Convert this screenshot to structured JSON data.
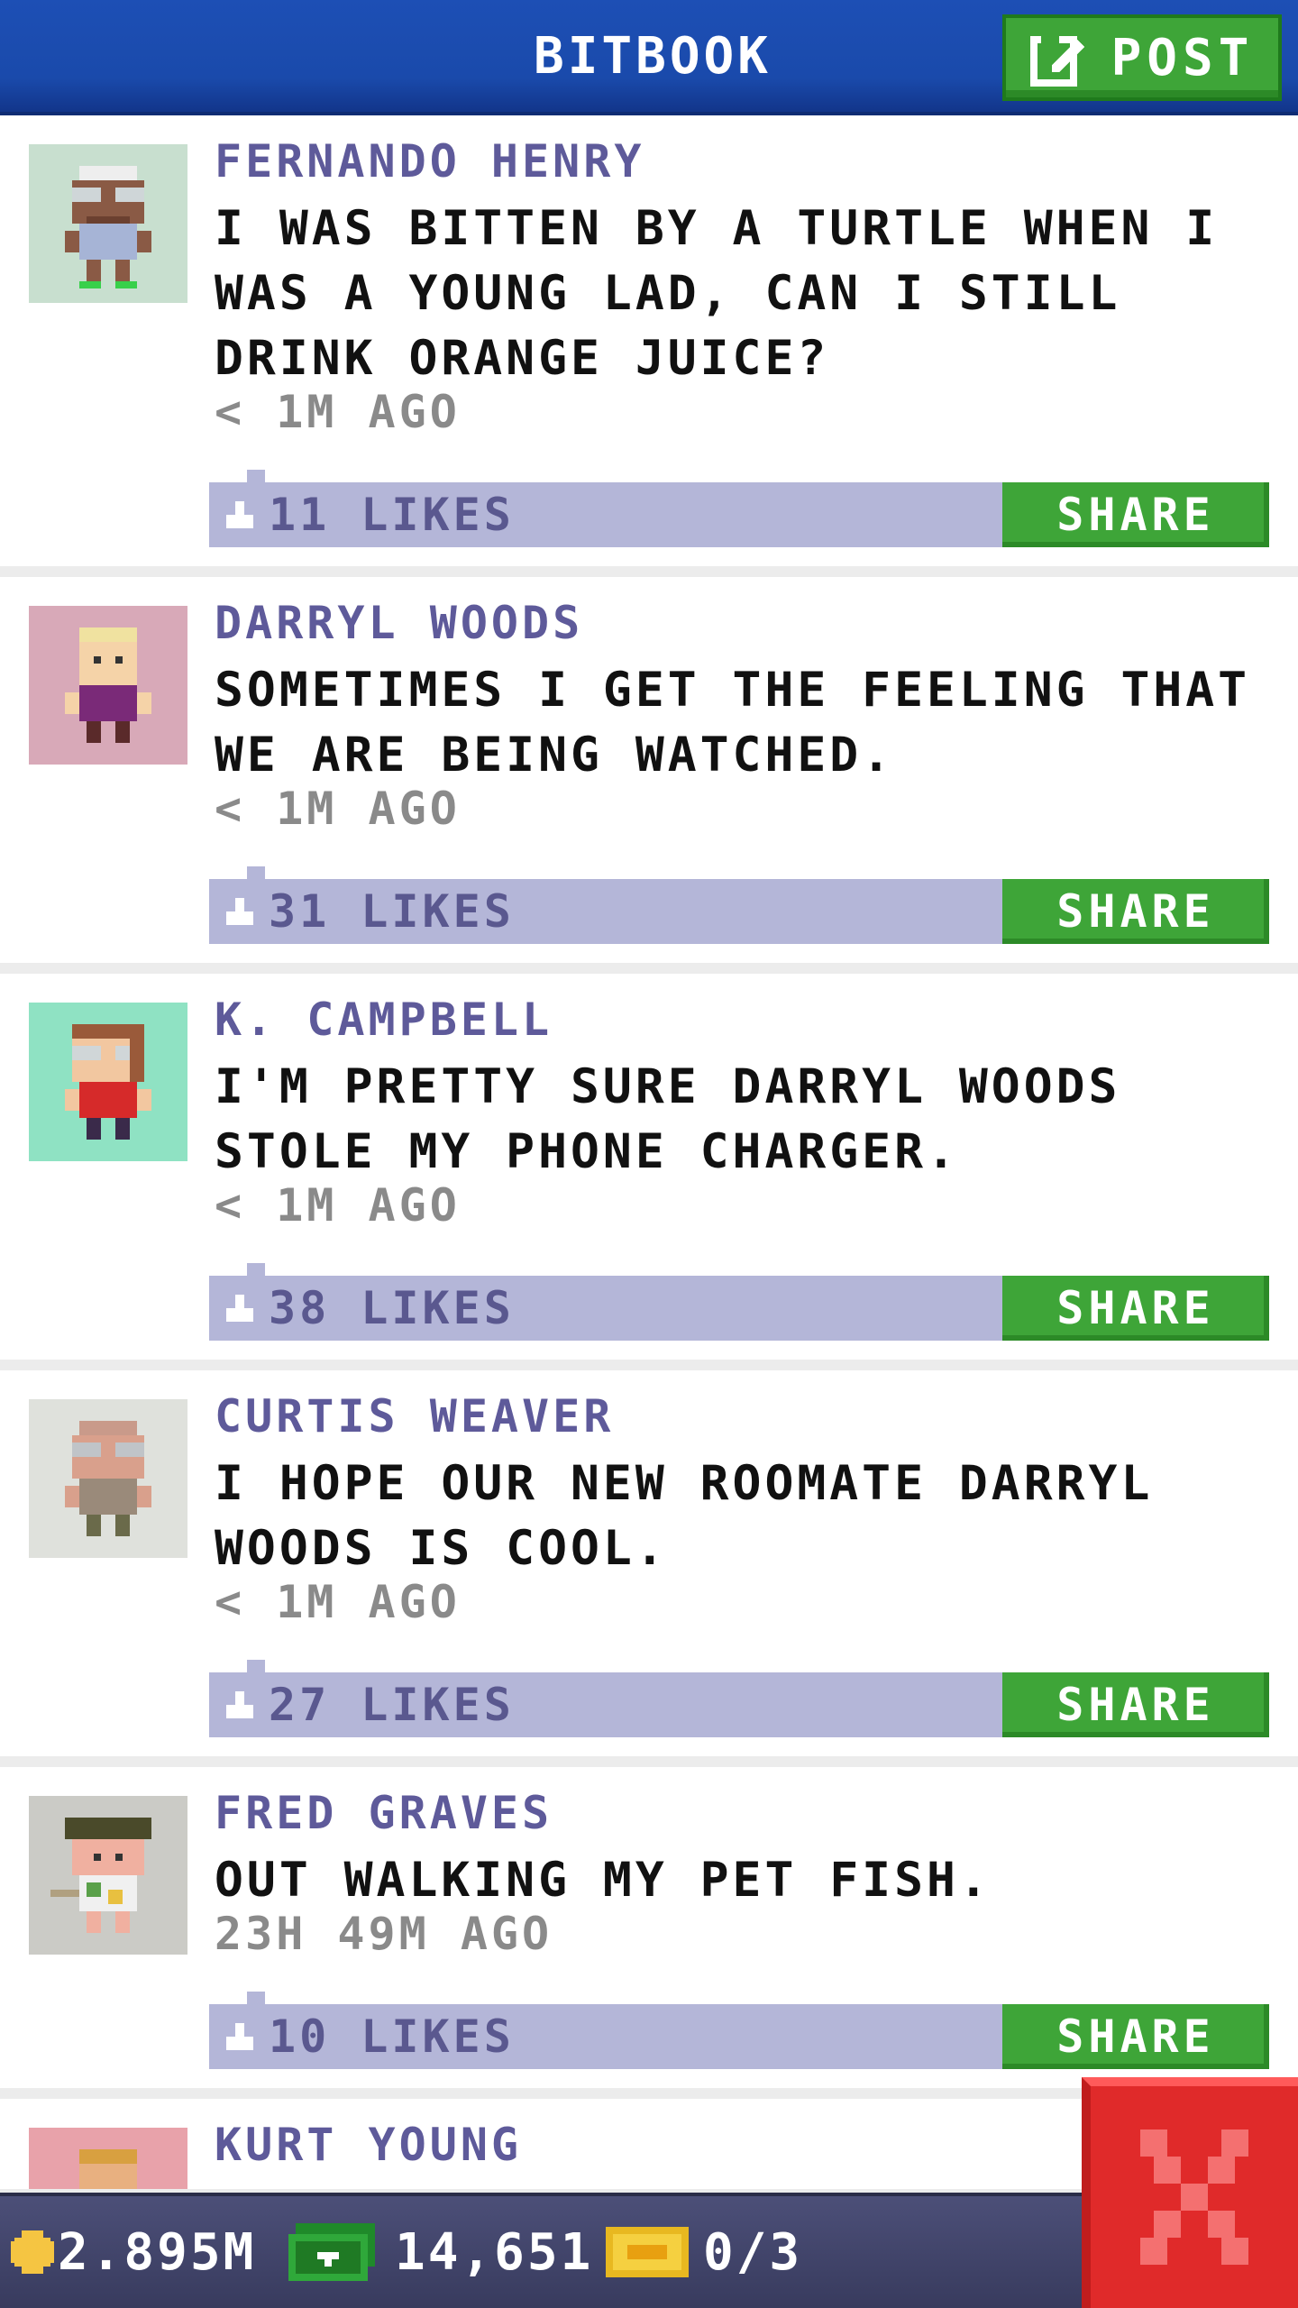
{
  "header": {
    "title": "BITBOOK",
    "post_label": "POST"
  },
  "posts": [
    {
      "author": "FERNANDO HENRY",
      "text": "I WAS BITTEN BY A TURTLE WHEN I WAS A YOUNG LAD, CAN I STILL DRINK ORANGE JUICE?",
      "time": "< 1M AGO",
      "likes": "11 LIKES",
      "share": "SHARE",
      "avatar_bg": "#c8dfcf"
    },
    {
      "author": "DARRYL WOODS",
      "text": "SOMETIMES I GET THE FEELING THAT WE ARE BEING WATCHED.",
      "time": "< 1M AGO",
      "likes": "31 LIKES",
      "share": "SHARE",
      "avatar_bg": "#d8a9b8"
    },
    {
      "author": "K. CAMPBELL",
      "text": "I'M PRETTY SURE DARRYL WOODS STOLE MY PHONE CHARGER.",
      "time": "< 1M AGO",
      "likes": "38 LIKES",
      "share": "SHARE",
      "avatar_bg": "#8fe2c3"
    },
    {
      "author": "CURTIS WEAVER",
      "text": "I HOPE OUR NEW ROOMATE DARRYL WOODS IS COOL.",
      "time": "< 1M AGO",
      "likes": "27 LIKES",
      "share": "SHARE",
      "avatar_bg": "#dfe1dc"
    },
    {
      "author": "FRED GRAVES",
      "text": "OUT WALKING MY PET FISH.",
      "time": "23H 49M AGO",
      "likes": "10 LIKES",
      "share": "SHARE",
      "avatar_bg": "#cbcbc6"
    },
    {
      "author": "KURT YOUNG",
      "text": "",
      "time": "",
      "likes": "",
      "share": "",
      "avatar_bg": "#e8a2aa"
    }
  ],
  "footer": {
    "coins": "2.895M",
    "bux": "14,651",
    "tickets": "0/3"
  },
  "colors": {
    "header_blue": "#1a4aab",
    "share_green": "#3ea538",
    "like_bar": "#b4b6d8",
    "author_purple": "#5e5a9a",
    "close_red": "#e02a2a"
  }
}
